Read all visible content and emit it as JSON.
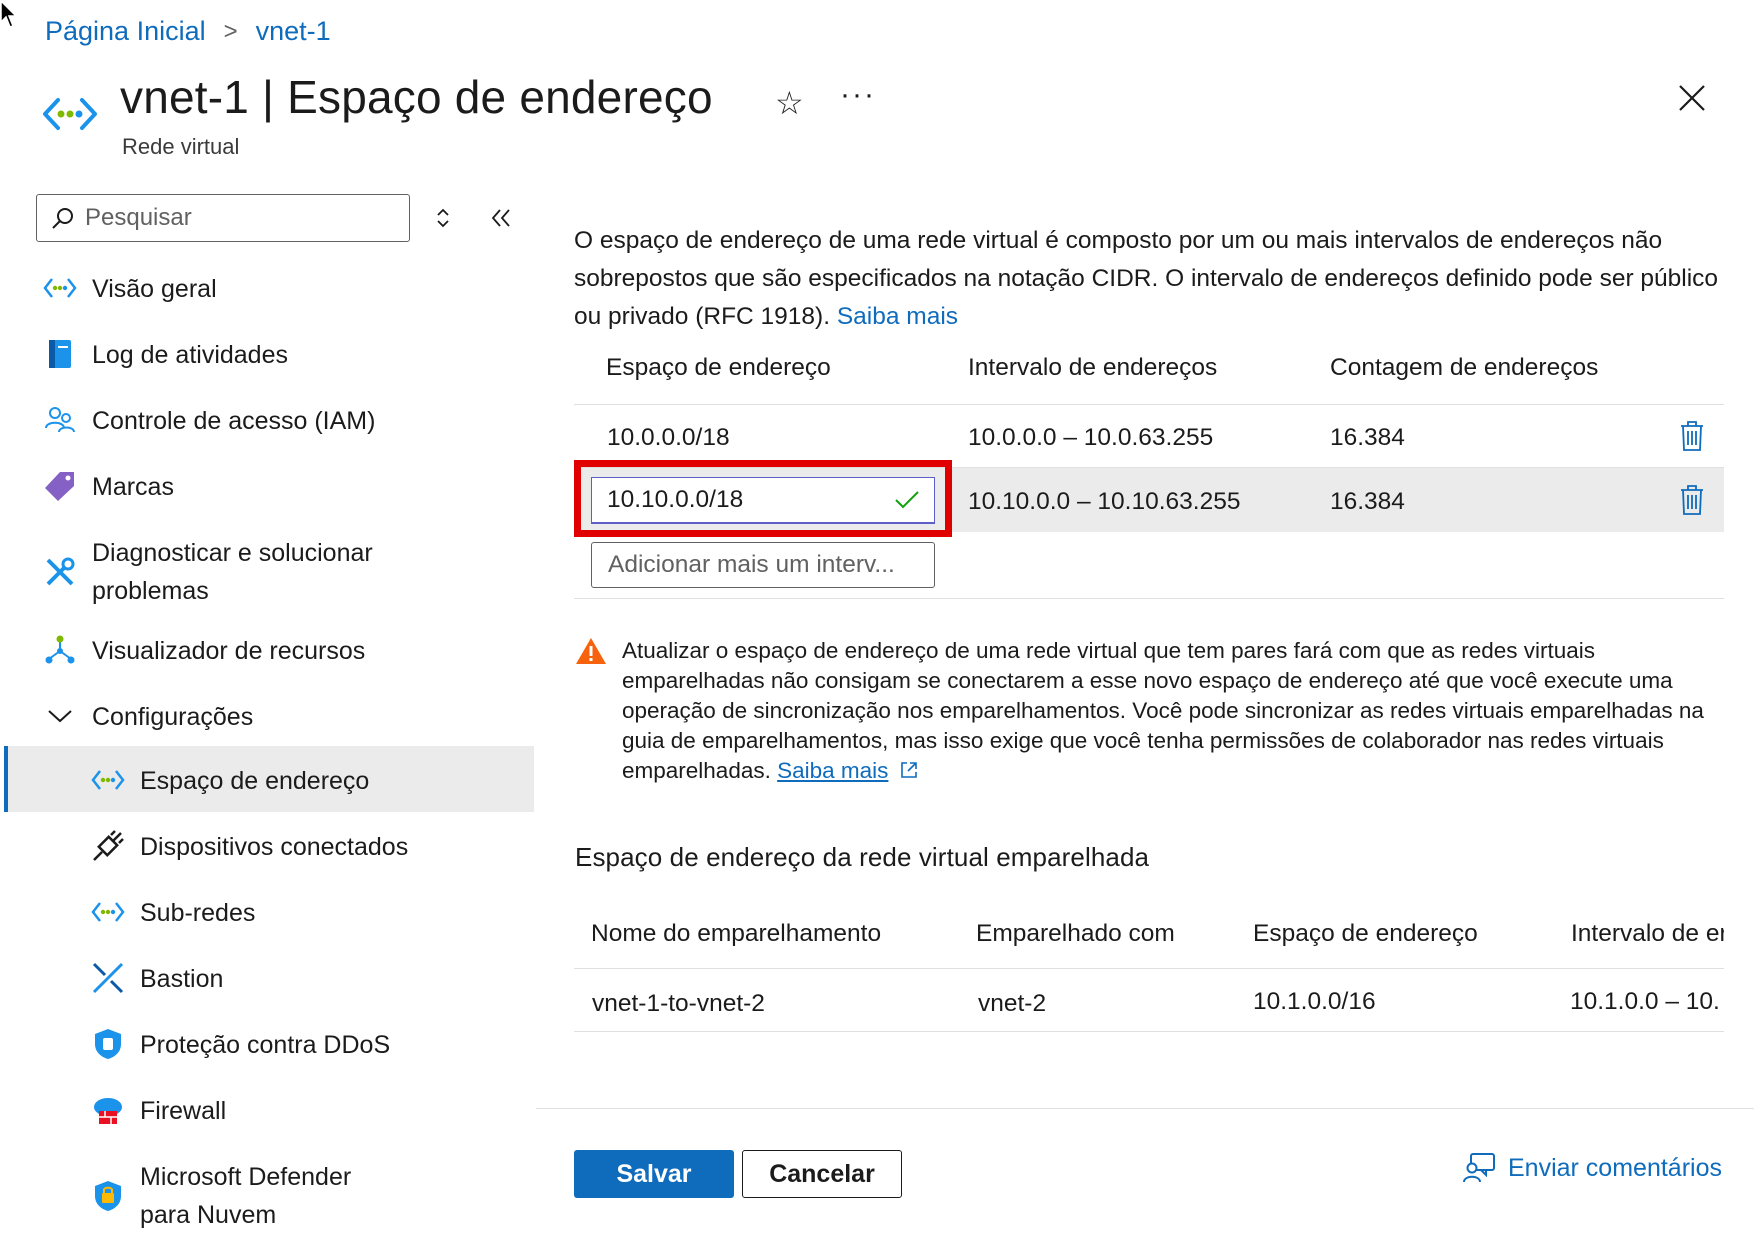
{
  "breadcrumb": {
    "home": "Página Inicial",
    "current": "vnet-1"
  },
  "header": {
    "title": "vnet-1 | Espaço de endereço",
    "subtitle": "Rede virtual",
    "more_label": "···"
  },
  "sidebar": {
    "search_placeholder": "Pesquisar",
    "items": [
      {
        "label": "Visão geral",
        "icon": "vnet-icon"
      },
      {
        "label": "Log de atividades",
        "icon": "activity-log-icon"
      },
      {
        "label": "Controle de acesso (IAM)",
        "icon": "iam-icon"
      },
      {
        "label": "Marcas",
        "icon": "tag-icon"
      },
      {
        "label": "Diagnosticar e solucionar problemas",
        "icon": "wrench-icon"
      },
      {
        "label": "Visualizador de recursos",
        "icon": "resource-visualizer-icon"
      },
      {
        "label": "Configurações",
        "icon": "chevron-down-icon"
      },
      {
        "label": "Espaço de endereço",
        "icon": "vnet-icon",
        "active": true
      },
      {
        "label": "Dispositivos conectados",
        "icon": "plug-icon"
      },
      {
        "label": "Sub-redes",
        "icon": "vnet-icon"
      },
      {
        "label": "Bastion",
        "icon": "bastion-icon"
      },
      {
        "label": "Proteção contra DDoS",
        "icon": "shield-icon"
      },
      {
        "label": "Firewall",
        "icon": "firewall-icon"
      },
      {
        "label": "Microsoft Defender para Nuvem",
        "icon": "defender-icon"
      }
    ]
  },
  "main": {
    "description": "O espaço de endereço de uma rede virtual é composto por um ou mais intervalos de endereços não sobrepostos que são especificados na notação CIDR. O intervalo de endereços definido pode ser público ou privado (RFC 1918).",
    "learn_more": "Saiba mais",
    "address_table": {
      "headers": [
        "Espaço de endereço",
        "Intervalo de endereços",
        "Contagem de endereços"
      ],
      "rows": [
        {
          "space": "10.0.0.0/18",
          "range": "10.0.0.0 – 10.0.63.255",
          "count": "16.384"
        },
        {
          "space": "10.10.0.0/18",
          "range": "10.10.0.0 – 10.10.63.255",
          "count": "16.384"
        }
      ],
      "add_placeholder": "Adicionar mais um interv..."
    },
    "warning": {
      "text": "Atualizar o espaço de endereço de uma rede virtual que tem pares fará com que as redes virtuais emparelhadas não consigam se conectarem a esse novo espaço de endereço até que você execute uma operação de sincronização nos emparelhamentos. Você pode sincronizar as redes virtuais emparelhadas na guia de emparelhamentos, mas isso exige que você tenha permissões de colaborador nas redes virtuais emparelhadas.",
      "link": "Saiba mais"
    },
    "peered_section": {
      "title": "Espaço de endereço da rede virtual emparelhada",
      "headers": [
        "Nome do emparelhamento",
        "Emparelhado com",
        "Espaço de endereço",
        "Intervalo de er"
      ],
      "rows": [
        {
          "name": "vnet-1-to-vnet-2",
          "peer": "vnet-2",
          "space": "10.1.0.0/16",
          "range": "10.1.0.0 – 10."
        }
      ]
    }
  },
  "footer": {
    "save": "Salvar",
    "cancel": "Cancelar",
    "feedback": "Enviar comentários"
  },
  "colors": {
    "accent": "#0f6cbd",
    "highlight": "#e00000",
    "warning": "#f7630c",
    "success": "#13a10e"
  }
}
